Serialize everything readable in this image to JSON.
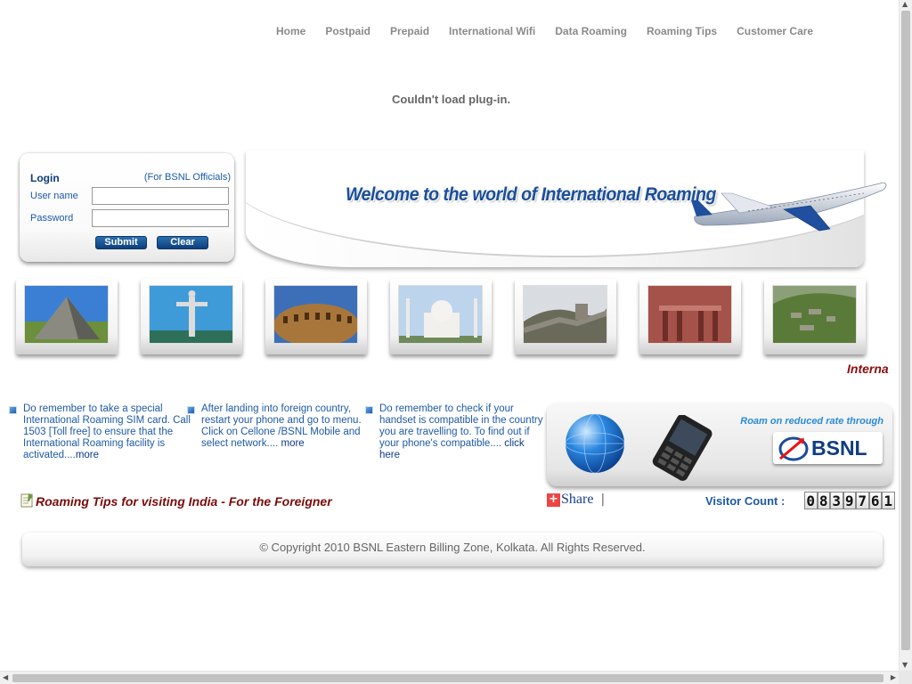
{
  "nav": [
    "Home",
    "Postpaid",
    "Prepaid",
    "International Wifi",
    "Data Roaming",
    "Roaming Tips",
    "Customer Care"
  ],
  "plugin_message": "Couldn't load plug-in.",
  "login": {
    "title": "Login",
    "subtitle": "(For BSNL Officials)",
    "username_label": "User name",
    "password_label": "Password",
    "username_value": "",
    "password_value": "",
    "submit_label": "Submit",
    "clear_label": "Clear"
  },
  "banner": {
    "title": "Welcome to the world of International Roaming"
  },
  "thumbnails": [
    "pyramid-photo",
    "christ-statue-photo",
    "colosseum-photo",
    "taj-mahal-photo",
    "great-wall-photo",
    "petra-photo",
    "machu-picchu-photo"
  ],
  "marquee_text": "Interna",
  "tips": [
    {
      "text": "Do remember to take a special International Roaming SIM card. Call 1503 [Toll free] to ensure that the International Roaming facility is activated....",
      "link": "more"
    },
    {
      "text": "After landing into foreign country, restart your phone and go to menu. Click on Cellone /BSNL Mobile and select network.... ",
      "link": "more"
    },
    {
      "text": "Do remember to check if your handset is compatible in the country you are travelling to. To find out if your phone's compatible.... ",
      "link": "click here"
    }
  ],
  "promo": {
    "tagline": "Roam on reduced rate through",
    "brand": "BSNL"
  },
  "foreigner_link": "Roaming Tips for visiting India - For the Foreigner",
  "share": {
    "label": "Share",
    "separator": "|"
  },
  "visitor": {
    "label": "Visitor Count :",
    "digits": [
      "0",
      "8",
      "3",
      "9",
      "7",
      "6",
      "1"
    ]
  },
  "footer": "© Copyright 2010 BSNL Eastern Billing Zone, Kolkata. All Rights Reserved.",
  "colors": {
    "brand_blue": "#1a4f9a",
    "link_blue": "#1e5aa6",
    "accent_red": "#8b0e0e"
  }
}
